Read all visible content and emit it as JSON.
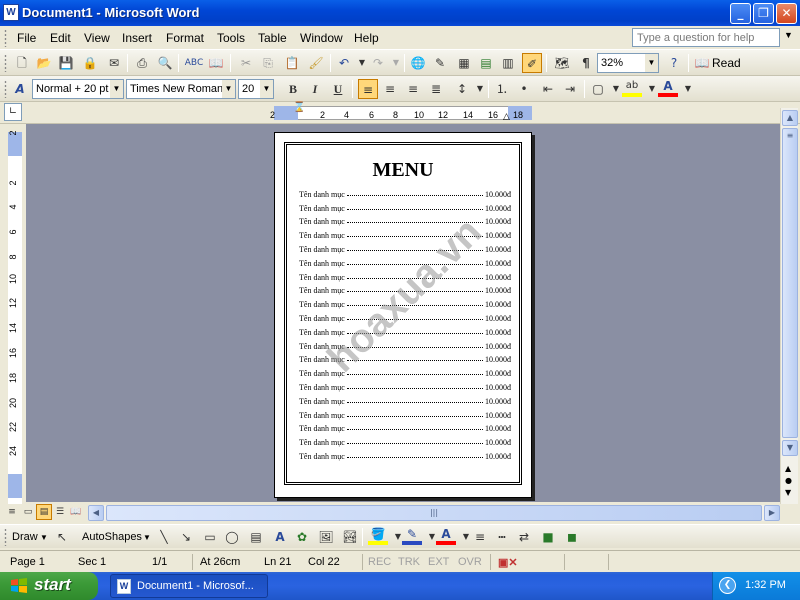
{
  "window": {
    "title": "Document1 - Microsoft Word",
    "app_icon": "W"
  },
  "menubar": {
    "items": [
      "File",
      "Edit",
      "View",
      "Insert",
      "Format",
      "Tools",
      "Table",
      "Window",
      "Help"
    ],
    "ask_placeholder": "Type a question for help"
  },
  "standard_toolbar": {
    "zoom": "32%",
    "read_label": "Read"
  },
  "formatting_toolbar": {
    "style": "Normal + 20 pt",
    "font": "Times New Roman",
    "size": "20",
    "bold": "B",
    "italic": "I",
    "underline": "U"
  },
  "ruler": {
    "labels": [
      "2",
      "2",
      "4",
      "6",
      "8",
      "10",
      "12",
      "14",
      "16",
      "18"
    ]
  },
  "vruler": {
    "labels": [
      "2",
      "2",
      "4",
      "6",
      "8",
      "10",
      "12",
      "14",
      "16",
      "18",
      "20",
      "22",
      "24"
    ]
  },
  "document": {
    "title": "MENU",
    "items": [
      {
        "name": "Tên danh mục",
        "price": "10.000đ"
      },
      {
        "name": "Tên danh mục",
        "price": "10.000đ"
      },
      {
        "name": "Tên danh mục",
        "price": "10.000đ"
      },
      {
        "name": "Tên danh mục",
        "price": "10.000đ"
      },
      {
        "name": "Tên danh mục",
        "price": "10.000đ"
      },
      {
        "name": "Tên danh mục",
        "price": "10.000đ"
      },
      {
        "name": "Tên danh mục",
        "price": "10.000đ"
      },
      {
        "name": "Tên danh mục",
        "price": "10.000đ"
      },
      {
        "name": "Tên danh mục",
        "price": "10.000đ"
      },
      {
        "name": "Tên danh mục",
        "price": "10.000đ"
      },
      {
        "name": "Tên danh mục",
        "price": "10.000đ"
      },
      {
        "name": "Tên danh mục",
        "price": "10.000đ"
      },
      {
        "name": "Tên danh mục",
        "price": "10.000đ"
      },
      {
        "name": "Tên danh mục",
        "price": "10.000đ"
      },
      {
        "name": "Tên danh mục",
        "price": "10.000đ"
      },
      {
        "name": "Tên danh mục",
        "price": "10.000đ"
      },
      {
        "name": "Tên danh mục",
        "price": "10.000đ"
      },
      {
        "name": "Tên danh mục",
        "price": "10.000đ"
      },
      {
        "name": "Tên danh mục",
        "price": "10.000đ"
      },
      {
        "name": "Tên danh mục",
        "price": "10.000đ"
      }
    ],
    "watermark": "hoaxua.vn"
  },
  "drawbar": {
    "draw_label": "Draw",
    "autoshapes_label": "AutoShapes"
  },
  "statusbar": {
    "page": "Page  1",
    "sec": "Sec  1",
    "pages": "1/1",
    "at": "At  26cm",
    "ln": "Ln  21",
    "col": "Col  22",
    "rec": "REC",
    "trk": "TRK",
    "ext": "EXT",
    "ovr": "OVR"
  },
  "taskbar": {
    "start_label": "start",
    "task_label": "Document1 - Microsof...",
    "clock": "1:32 PM"
  },
  "colors": {
    "highlight": "#FFFF00",
    "font_color": "#FF0000",
    "doc_background": "#8A8FA3"
  }
}
